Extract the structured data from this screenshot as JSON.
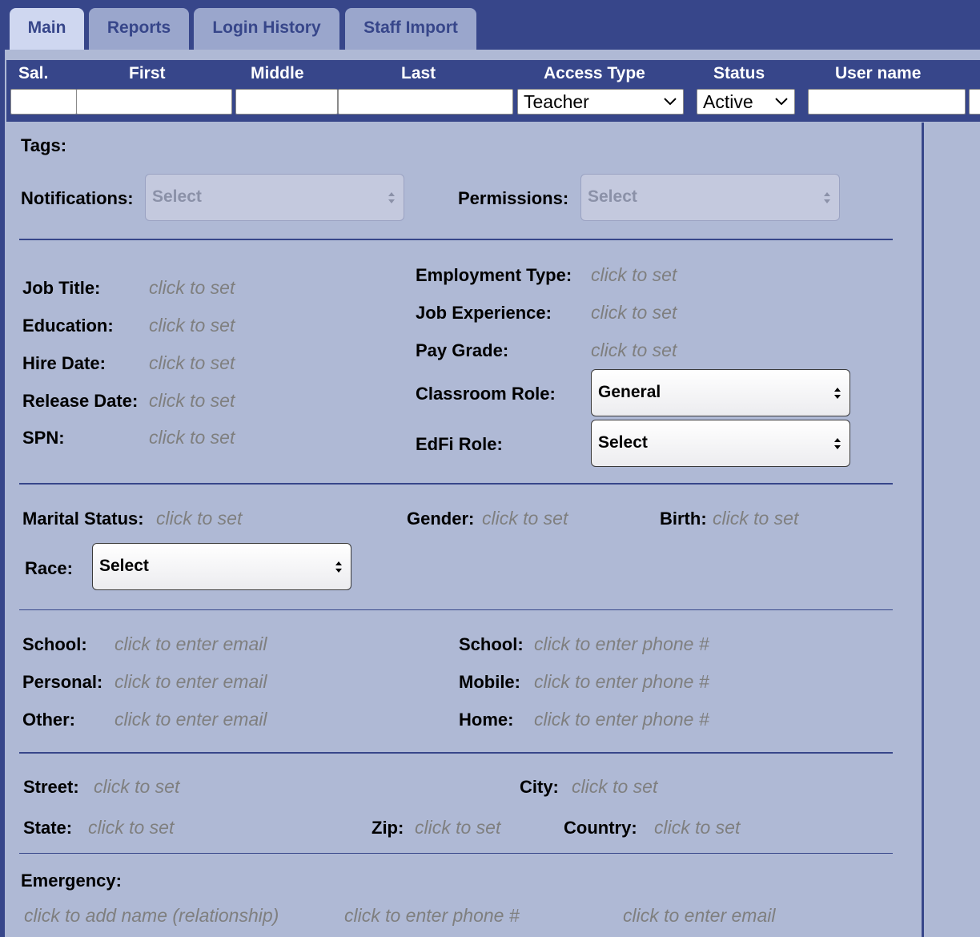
{
  "tabs": [
    {
      "label": "Main"
    },
    {
      "label": "Reports"
    },
    {
      "label": "Login History"
    },
    {
      "label": "Staff Import"
    }
  ],
  "header": {
    "labels": {
      "sal": "Sal.",
      "first": "First",
      "middle": "Middle",
      "last": "Last",
      "access_type": "Access Type",
      "status": "Status",
      "user_name": "User name"
    },
    "values": {
      "sal": "",
      "first": "",
      "middle": "",
      "last": "",
      "access_type": "Teacher",
      "status": "Active",
      "user_name": ""
    }
  },
  "tags": {
    "label": "Tags:",
    "notifications_label": "Notifications:",
    "notifications_value": "Select",
    "permissions_label": "Permissions:",
    "permissions_value": "Select"
  },
  "job": {
    "job_title_label": "Job Title:",
    "education_label": "Education:",
    "hire_date_label": "Hire Date:",
    "release_date_label": "Release Date:",
    "spn_label": "SPN:",
    "employment_type_label": "Employment Type:",
    "job_experience_label": "Job Experience:",
    "pay_grade_label": "Pay Grade:",
    "classroom_role_label": "Classroom Role:",
    "classroom_role_value": "General",
    "edfi_role_label": "EdFi Role:",
    "edfi_role_value": "Select",
    "placeholder": "click to set"
  },
  "personal": {
    "marital_label": "Marital Status:",
    "gender_label": "Gender:",
    "birth_label": "Birth:",
    "race_label": "Race:",
    "race_value": "Select",
    "placeholder": "click to set"
  },
  "contact": {
    "email_school_label": "School:",
    "email_personal_label": "Personal:",
    "email_other_label": "Other:",
    "phone_school_label": "School:",
    "phone_mobile_label": "Mobile:",
    "phone_home_label": "Home:",
    "email_placeholder": "click to enter email",
    "phone_placeholder": "click to enter phone #"
  },
  "address": {
    "street_label": "Street:",
    "city_label": "City:",
    "state_label": "State:",
    "zip_label": "Zip:",
    "country_label": "Country:",
    "placeholder": "click to set"
  },
  "emergency": {
    "label": "Emergency:",
    "name_placeholder": "click to add name (relationship)",
    "phone_placeholder": "click to enter phone #",
    "email_placeholder": "click to enter email"
  },
  "colors": {
    "brand": "#37468a",
    "panel": "#afb9d5",
    "active_tab": "#cfd7f0",
    "placeholder": "#7f7f7f"
  }
}
